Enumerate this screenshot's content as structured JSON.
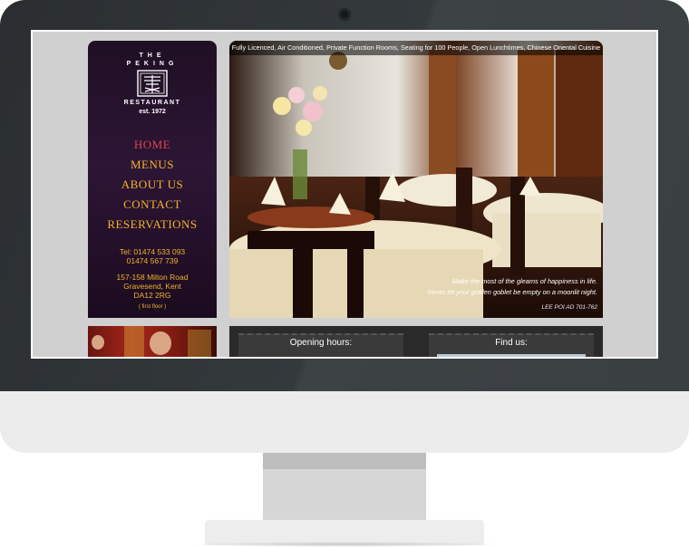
{
  "site": {
    "logo": {
      "line1": "THE",
      "line2": "PEKING",
      "line3": "RESTAURANT",
      "established": "est. 1972"
    },
    "nav": [
      {
        "label": "Home",
        "active": true
      },
      {
        "label": "Menus",
        "active": false
      },
      {
        "label": "About Us",
        "active": false
      },
      {
        "label": "Contact",
        "active": false
      },
      {
        "label": "Reservations",
        "active": false
      }
    ],
    "contact": {
      "tel1": "Tel: 01474 533 093",
      "tel2": "01474 567 739",
      "address1": "157-158 Milton Road",
      "address2": "Gravesend, Kent",
      "address3": "DA12 2RG",
      "floor": "( first floor )"
    },
    "hero": {
      "banner": "Fully Licenced, Air Conditioned, Private Function Rooms, Seating for 100 People, Open Lunchtimes, Chinese Oriental Cuisine",
      "quote_line1": "Make the most of the gleams of happiness in life.",
      "quote_line2": "Never let your golden goblet be empty on a moonlit night.",
      "quote_author": "LEE POI AD 701-762"
    },
    "panels": {
      "hours_title": "Opening hours:",
      "findus_title": "Find us:"
    }
  },
  "colors": {
    "nav_gold": "#f3b22e",
    "nav_active": "#e0434f",
    "sidebar_bg": "#2d1535",
    "page_bg": "#d0d0d0"
  }
}
